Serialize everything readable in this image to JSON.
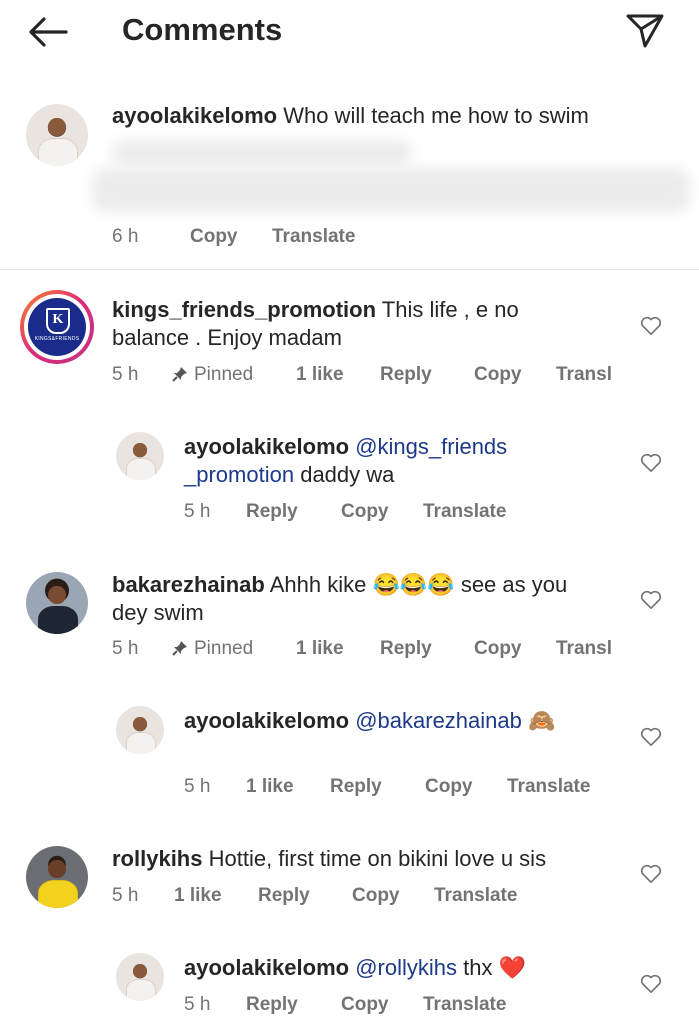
{
  "header": {
    "title": "Comments"
  },
  "comments": [
    {
      "username": "ayoolakikelomo",
      "text": "Who will teach me how to swim",
      "time": "6 h",
      "copy": "Copy",
      "translate": "Translate"
    },
    {
      "username": "kings_friends_promotion",
      "text_line1": "This life , e no",
      "text_line2": "balance . Enjoy madam",
      "time": "5 h",
      "pinned": "Pinned",
      "likes": "1 like",
      "reply": "Reply",
      "copy": "Copy",
      "translate": "Transl",
      "avatar_logo_text": "KINGS&FRIENDS"
    },
    {
      "username": "ayoolakikelomo",
      "mention_line1": "@kings_friends",
      "mention_line2": "_promotion",
      "text": "daddy wa",
      "time": "5 h",
      "reply": "Reply",
      "copy": "Copy",
      "translate": "Translate"
    },
    {
      "username": "bakarezhainab",
      "text_part1": "Ahhh kike",
      "emoji": "😂😂😂",
      "text_part2": "see as you",
      "text_line2": "dey swim",
      "time": "5 h",
      "pinned": "Pinned",
      "likes": "1 like",
      "reply": "Reply",
      "copy": "Copy",
      "translate": "Transl"
    },
    {
      "username": "ayoolakikelomo",
      "mention": "@bakarezhainab",
      "emoji": "🙈",
      "time": "5 h",
      "likes": "1 like",
      "reply": "Reply",
      "copy": "Copy",
      "translate": "Translate"
    },
    {
      "username": "rollykihs",
      "text": "Hottie, first time on bikini love u sis",
      "time": "5 h",
      "likes": "1 like",
      "reply": "Reply",
      "copy": "Copy",
      "translate": "Translate"
    },
    {
      "username": "ayoolakikelomo",
      "mention": "@rollykihs",
      "text": "thx",
      "emoji": "❤️",
      "time": "5 h",
      "reply": "Reply",
      "copy": "Copy",
      "translate": "Translate"
    }
  ],
  "icons": {
    "back": "back-arrow-icon",
    "share": "direct-share-icon",
    "like": "heart-outline-icon",
    "pin": "pin-icon"
  },
  "colors": {
    "text": "#262626",
    "meta": "#737373",
    "mention": "#1d3a8a",
    "logo_ring_start": "#f58529",
    "logo_ring_end": "#c13584",
    "logo_bg": "#1a2b8c",
    "heart_emoji": "#e0242f"
  }
}
